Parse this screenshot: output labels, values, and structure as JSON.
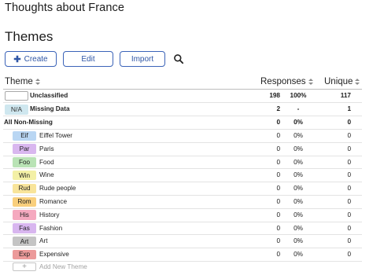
{
  "app": {
    "title": "Thoughts about France"
  },
  "page": {
    "title": "Themes"
  },
  "toolbar": {
    "create_label": "Create",
    "create_icon": "plus-icon",
    "edit_label": "Edit",
    "import_label": "Import",
    "search_icon": "search-icon"
  },
  "table": {
    "headers": {
      "theme": "Theme",
      "responses": "Responses",
      "unique": "Unique"
    },
    "unclassified": {
      "name": "Unclassified",
      "responses": "198",
      "pct": "100%",
      "unique": "117"
    },
    "missing": {
      "abbrev": "N/A",
      "name": "Missing Data",
      "responses": "2",
      "pct": "-",
      "unique": "1"
    },
    "non_missing": {
      "name": "All Non-Missing",
      "responses": "0",
      "pct": "0%",
      "unique": "0"
    },
    "themes": [
      {
        "abbrev": "Eif",
        "name": "Eiffel Tower",
        "responses": "0",
        "pct": "0%",
        "unique": "0",
        "color": "#b9d6f3"
      },
      {
        "abbrev": "Par",
        "name": "Paris",
        "responses": "0",
        "pct": "0%",
        "unique": "0",
        "color": "#d9b7ef"
      },
      {
        "abbrev": "Foo",
        "name": "Food",
        "responses": "0",
        "pct": "0%",
        "unique": "0",
        "color": "#b9e3b5"
      },
      {
        "abbrev": "Win",
        "name": "Wine",
        "responses": "0",
        "pct": "0%",
        "unique": "0",
        "color": "#f3f0a6"
      },
      {
        "abbrev": "Rud",
        "name": "Rude people",
        "responses": "0",
        "pct": "0%",
        "unique": "0",
        "color": "#f8e49a"
      },
      {
        "abbrev": "Rom",
        "name": "Romance",
        "responses": "0",
        "pct": "0%",
        "unique": "0",
        "color": "#f9cf7c"
      },
      {
        "abbrev": "His",
        "name": "History",
        "responses": "0",
        "pct": "0%",
        "unique": "0",
        "color": "#f5a9bf"
      },
      {
        "abbrev": "Fas",
        "name": "Fashion",
        "responses": "0",
        "pct": "0%",
        "unique": "0",
        "color": "#d8b6ef"
      },
      {
        "abbrev": "Art",
        "name": "Art",
        "responses": "0",
        "pct": "0%",
        "unique": "0",
        "color": "#c4c4c4"
      },
      {
        "abbrev": "Exp",
        "name": "Expensive",
        "responses": "0",
        "pct": "0%",
        "unique": "0",
        "color": "#ec9a9a"
      }
    ],
    "add_new": {
      "icon": "plus-icon",
      "label": "Add New Theme"
    }
  },
  "colors": {
    "accent": "#3b63b8",
    "divider": "#e3e3e3"
  }
}
